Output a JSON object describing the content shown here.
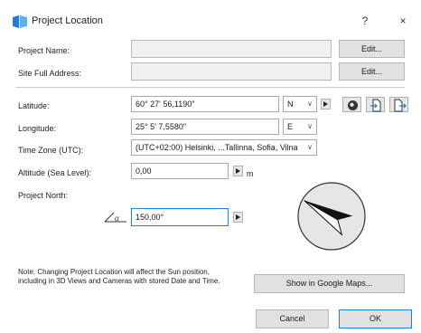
{
  "window": {
    "title": "Project Location",
    "help_glyph": "?",
    "close_glyph": "×"
  },
  "project": {
    "name_label": "Project Name:",
    "name_value": "",
    "address_label": "Site Full Address:",
    "address_value": "",
    "edit_label": "Edit..."
  },
  "coords": {
    "latitude_label": "Latitude:",
    "latitude_value": "60° 27' 56,1190\"",
    "latitude_hemi": "N",
    "longitude_label": "Longitude:",
    "longitude_value": "25° 5' 7,5580\"",
    "longitude_hemi": "E",
    "timezone_label": "Time Zone (UTC):",
    "timezone_value": "(UTC+02:00) Helsinki, ...Tallinna, Sofia, Vilna",
    "altitude_label": "Altitude (Sea Level):",
    "altitude_value": "0,00",
    "altitude_unit": "m"
  },
  "north": {
    "label": "Project North:",
    "angle_value": "150,00°",
    "angle_icon_text": "α",
    "angle_deg": 150
  },
  "tools": {
    "globe_icon": "globe-icon",
    "import_icon": "import-file-icon",
    "export_icon": "export-file-icon"
  },
  "note": {
    "line1": "Note: Changing Project Location will affect the Sun position,",
    "line2": "including in 3D Views and Cameras with stored Date and Time."
  },
  "buttons": {
    "google_maps": "Show in Google Maps...",
    "cancel": "Cancel",
    "ok": "OK"
  },
  "colors": {
    "accent": "#1e7ed6",
    "compass_fill": "#e6e6e6"
  }
}
